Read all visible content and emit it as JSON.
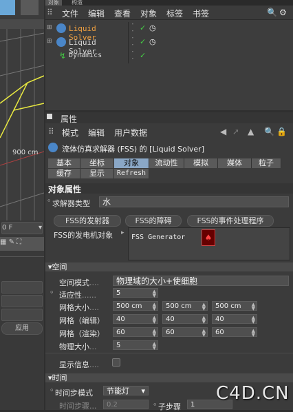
{
  "viewport": {
    "distance_label": "900 cm",
    "frame_value": "0 F",
    "apply_label": "应用"
  },
  "object_manager": {
    "tabs": [
      "对象",
      "构造"
    ],
    "menu": [
      "文件",
      "编辑",
      "查看",
      "对象",
      "标签",
      "书签"
    ],
    "items": [
      {
        "label": "Liquid Solver",
        "color": "#f0a040"
      },
      {
        "label": "Liquid Solver",
        "color": "#e0e0e0"
      },
      {
        "label": "Dynamics",
        "color": "#e0e0e0"
      }
    ]
  },
  "attributes": {
    "panel_title": "属性",
    "menu": [
      "模式",
      "编辑",
      "用户数据"
    ],
    "object_title": "流体仿真求解器 (FSS) 的 [Liquid Solver]",
    "tabs_row1": [
      "基本",
      "坐标",
      "对象",
      "流动性",
      "模拟",
      "媒体",
      "粒子"
    ],
    "tabs_row2": [
      "缓存",
      "显示",
      "Refresh"
    ],
    "selected_tab": "对象",
    "section_title": "对象属性",
    "solver_type_label": "求解器类型",
    "solver_type_value": "水",
    "fss_buttons": [
      "FSS的发射器",
      "FSS的障碍",
      "FSS的事件处理程序"
    ],
    "generator_label": "FSS的发电机对象",
    "generator_item": "FSS Generator",
    "space": {
      "title": "空间",
      "space_mode_label": "空间模式",
      "space_mode_value": "物理域的大小+使细胞",
      "adaptivity_label": "适应性",
      "adaptivity_value": "5",
      "grid_size_label": "网格大小",
      "grid_size_values": [
        "500 cm",
        "500 cm",
        "500 cm"
      ],
      "grid_edit_label": "网格（编辑）",
      "grid_edit_values": [
        "40",
        "40",
        "40"
      ],
      "grid_render_label": "网格（渲染）",
      "grid_render_values": [
        "60",
        "60",
        "60"
      ],
      "physical_size_label": "物理大小",
      "physical_size_value": "5",
      "show_info_label": "显示信息"
    },
    "time": {
      "title": "时间",
      "timestep_mode_label": "时间步模式",
      "timestep_mode_value": "节能灯",
      "timestep_label": "时间步骤",
      "timestep_value": "0.2",
      "substep_label": "子步骤",
      "substep_value": "1"
    }
  },
  "watermark": "C4D.CN"
}
